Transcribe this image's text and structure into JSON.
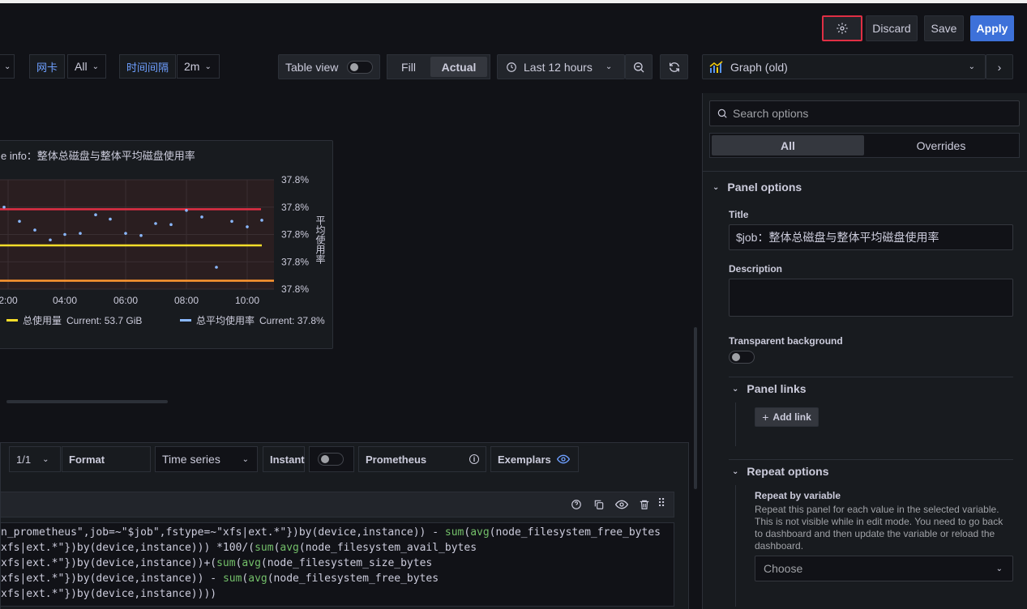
{
  "toolbar": {
    "discard_label": "Discard",
    "save_label": "Save",
    "apply_label": "Apply"
  },
  "variables": {
    "nic_label": "网卡",
    "nic_value": "All",
    "interval_label": "时间间隔",
    "interval_value": "2m"
  },
  "view_controls": {
    "table_view_label": "Table view",
    "fill_label": "Fill",
    "actual_label": "Actual",
    "time_range_label": "Last 12 hours"
  },
  "viz_picker": {
    "label": "Graph (old)"
  },
  "graph_panel": {
    "title_fragment": "e info：整体总磁盘与整体平均磁盘使用率",
    "y2_label": "平均使用率",
    "legend": [
      {
        "name": "总使用量",
        "current": "Current: 53.7 GiB",
        "color": "#fade2a"
      },
      {
        "name": "总平均使用率",
        "current": "Current: 37.8%",
        "color": "#8ab8ff"
      }
    ]
  },
  "chart_data": {
    "type": "line",
    "x_ticks": [
      "2:00",
      "04:00",
      "06:00",
      "08:00",
      "10:00"
    ],
    "y2_ticks": [
      "37.8%",
      "37.8%",
      "37.8%",
      "37.8%",
      "37.8%"
    ],
    "ylabel": "平均使用率",
    "series": [
      {
        "name": "总平均使用率",
        "type": "scatter",
        "color": "#8ab8ff",
        "values": [
          0.42,
          0.48,
          0.14,
          0.13,
          0.37,
          0.11,
          0.56,
          0.37,
          0.69,
          0.69,
          0.39,
          0.65,
          0.62,
          0.66,
          0.63,
          0.65,
          0.73,
          1.1,
          0.98,
          1.08,
          0.05,
          0.47,
          0.62,
          0.69
        ]
      },
      {
        "name": "总使用量",
        "type": "line",
        "color": "#fade2a",
        "values": [
          0.42,
          0.42
        ]
      }
    ],
    "extra_lines": [
      {
        "color": "#e02f44",
        "value": 0.85
      },
      {
        "color": "#ff9830",
        "value": 0.0
      }
    ],
    "y_range": [
      -0.1,
      1.2
    ],
    "grid": true
  },
  "query_bar": {
    "pager": "1/1",
    "format_label": "Format",
    "format_value": "Time series",
    "instant_label": "Instant",
    "datasource_label": "Prometheus",
    "exemplars_label": "Exemplars"
  },
  "query_lines": [
    [
      {
        "t": "n_prometheus\",job=~\"$job\",fstype=~\"xfs|ext.*\"})by(device,instance)) - ",
        "c": ""
      },
      {
        "t": "sum",
        "c": "fn"
      },
      {
        "t": "(",
        "c": ""
      },
      {
        "t": "avg",
        "c": "fn"
      },
      {
        "t": "(node_filesystem_free_bytes",
        "c": ""
      }
    ],
    [
      {
        "t": "xfs|ext.*\"})by(device,instance))) *100/(",
        "c": ""
      },
      {
        "t": "sum",
        "c": "fn"
      },
      {
        "t": "(",
        "c": ""
      },
      {
        "t": "avg",
        "c": "fn"
      },
      {
        "t": "(node_filesystem_avail_bytes",
        "c": ""
      }
    ],
    [
      {
        "t": "xfs|ext.*\"})by(device,instance))+(",
        "c": ""
      },
      {
        "t": "sum",
        "c": "fn"
      },
      {
        "t": "(",
        "c": ""
      },
      {
        "t": "avg",
        "c": "fn"
      },
      {
        "t": "(node_filesystem_size_bytes",
        "c": ""
      }
    ],
    [
      {
        "t": "xfs|ext.*\"})by(device,instance)) - ",
        "c": ""
      },
      {
        "t": "sum",
        "c": "fn"
      },
      {
        "t": "(",
        "c": ""
      },
      {
        "t": "avg",
        "c": "fn"
      },
      {
        "t": "(node_filesystem_free_bytes",
        "c": ""
      }
    ],
    [
      {
        "t": "xfs|ext.*\"})by(device,instance))))",
        "c": ""
      }
    ]
  ],
  "options": {
    "search_placeholder": "Search options",
    "tab_all": "All",
    "tab_overrides": "Overrides",
    "panel_options_label": "Panel options",
    "title_label": "Title",
    "title_value": "$job：整体总磁盘与整体平均磁盘使用率",
    "description_label": "Description",
    "transparent_label": "Transparent background",
    "panel_links_label": "Panel links",
    "add_link_label": "Add link",
    "repeat_options_label": "Repeat options",
    "repeat_by_label": "Repeat by variable",
    "repeat_help": "Repeat this panel for each value in the selected variable. This is not visible while in edit mode. You need to go back to dashboard and then update the variable or reload the dashboard.",
    "choose_placeholder": "Choose"
  }
}
